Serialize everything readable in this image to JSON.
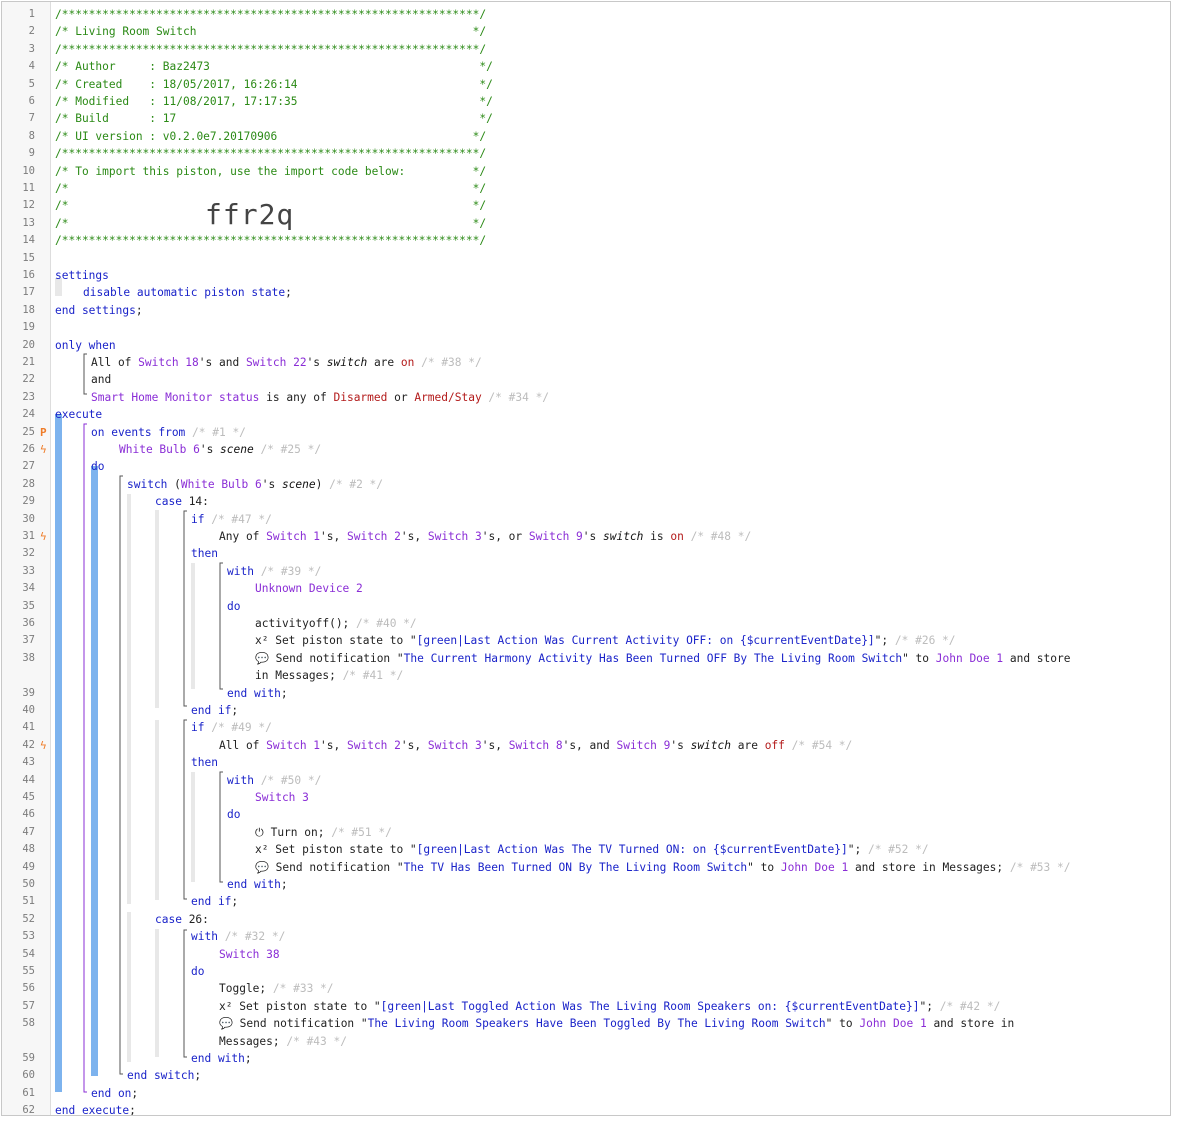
{
  "import_code": "ffr2q",
  "lines": [
    {
      "n": "1",
      "indent": 53,
      "t": [
        [
          "c",
          "/**************************************************************/"
        ]
      ]
    },
    {
      "n": "2",
      "indent": 53,
      "t": [
        [
          "c",
          "/* Living Room Switch                                         */"
        ]
      ]
    },
    {
      "n": "3",
      "indent": 53,
      "t": [
        [
          "c",
          "/**************************************************************/"
        ]
      ]
    },
    {
      "n": "4",
      "indent": 53,
      "t": [
        [
          "c",
          "/* Author     : Baz2473                                        */"
        ]
      ]
    },
    {
      "n": "5",
      "indent": 53,
      "t": [
        [
          "c",
          "/* Created    : 18/05/2017, 16:26:14                           */"
        ]
      ]
    },
    {
      "n": "6",
      "indent": 53,
      "t": [
        [
          "c",
          "/* Modified   : 11/08/2017, 17:17:35                           */"
        ]
      ]
    },
    {
      "n": "7",
      "indent": 53,
      "t": [
        [
          "c",
          "/* Build      : 17                                             */"
        ]
      ]
    },
    {
      "n": "8",
      "indent": 53,
      "t": [
        [
          "c",
          "/* UI version : v0.2.0e7.20170906                             */"
        ]
      ]
    },
    {
      "n": "9",
      "indent": 53,
      "t": [
        [
          "c",
          "/**************************************************************/"
        ]
      ]
    },
    {
      "n": "10",
      "indent": 53,
      "t": [
        [
          "c",
          "/* To import this piston, use the import code below:          */"
        ]
      ]
    },
    {
      "n": "11",
      "indent": 53,
      "t": [
        [
          "c",
          "/*                                                            */"
        ]
      ]
    },
    {
      "n": "12",
      "indent": 53,
      "t": [
        [
          "c",
          "/*                                                            */"
        ]
      ]
    },
    {
      "n": "13",
      "indent": 53,
      "t": [
        [
          "c",
          "/*                                                            */"
        ]
      ]
    },
    {
      "n": "14",
      "indent": 53,
      "t": [
        [
          "c",
          "/**************************************************************/"
        ]
      ]
    },
    {
      "n": "15",
      "indent": 53,
      "t": []
    },
    {
      "n": "16",
      "indent": 53,
      "t": [
        [
          "k",
          "settings"
        ]
      ]
    },
    {
      "n": "17",
      "indent": 81,
      "t": [
        [
          "k",
          "disable automatic piston state"
        ],
        [
          "p",
          ";"
        ]
      ]
    },
    {
      "n": "18",
      "indent": 53,
      "t": [
        [
          "k",
          "end settings"
        ],
        [
          "p",
          ";"
        ]
      ]
    },
    {
      "n": "19",
      "indent": 53,
      "t": []
    },
    {
      "n": "20",
      "indent": 53,
      "t": [
        [
          "k",
          "only when"
        ]
      ]
    },
    {
      "n": "21",
      "indent": 89,
      "t": [
        [
          "p",
          "All of "
        ],
        [
          "d",
          "Switch 18"
        ],
        [
          "p",
          "'s and "
        ],
        [
          "d",
          "Switch 22"
        ],
        [
          "p",
          "'s "
        ],
        [
          "a",
          "switch"
        ],
        [
          "p",
          " are "
        ],
        [
          "v",
          "on"
        ],
        [
          "x",
          " /* #38 */"
        ]
      ]
    },
    {
      "n": "22",
      "indent": 89,
      "t": [
        [
          "p",
          "and"
        ]
      ]
    },
    {
      "n": "23",
      "indent": 89,
      "t": [
        [
          "d",
          "Smart Home Monitor status"
        ],
        [
          "p",
          " is any of "
        ],
        [
          "v",
          "Disarmed"
        ],
        [
          "p",
          " or "
        ],
        [
          "v",
          "Armed/Stay"
        ],
        [
          "x",
          " /* #34 */"
        ]
      ]
    },
    {
      "n": "24",
      "indent": 53,
      "t": [
        [
          "k",
          "execute"
        ]
      ]
    },
    {
      "n": "25",
      "indent": 89,
      "flag": "P",
      "t": [
        [
          "k",
          "on events from"
        ],
        [
          "x",
          " /* #1 */"
        ]
      ]
    },
    {
      "n": "26",
      "indent": 117,
      "flag": "bolt",
      "t": [
        [
          "d",
          "White Bulb 6"
        ],
        [
          "p",
          "'s "
        ],
        [
          "a",
          "scene"
        ],
        [
          "x",
          " /* #25 */"
        ]
      ]
    },
    {
      "n": "27",
      "indent": 89,
      "t": [
        [
          "k",
          "do"
        ]
      ]
    },
    {
      "n": "28",
      "indent": 125,
      "t": [
        [
          "k",
          "switch"
        ],
        [
          "p",
          " ("
        ],
        [
          "d",
          "White Bulb 6"
        ],
        [
          "p",
          "'s "
        ],
        [
          "a",
          "scene"
        ],
        [
          "p",
          ")"
        ],
        [
          "x",
          " /* #2 */"
        ]
      ]
    },
    {
      "n": "29",
      "indent": 153,
      "t": [
        [
          "k",
          "case"
        ],
        [
          "p",
          " 14:"
        ]
      ]
    },
    {
      "n": "30",
      "indent": 189,
      "t": [
        [
          "k",
          "if"
        ],
        [
          "x",
          " /* #47 */"
        ]
      ]
    },
    {
      "n": "31",
      "indent": 217,
      "flag": "bolt",
      "t": [
        [
          "p",
          "Any of "
        ],
        [
          "d",
          "Switch 1"
        ],
        [
          "p",
          "'s, "
        ],
        [
          "d",
          "Switch 2"
        ],
        [
          "p",
          "'s, "
        ],
        [
          "d",
          "Switch 3"
        ],
        [
          "p",
          "'s, or "
        ],
        [
          "d",
          "Switch 9"
        ],
        [
          "p",
          "'s "
        ],
        [
          "a",
          "switch"
        ],
        [
          "p",
          " is "
        ],
        [
          "v",
          "on"
        ],
        [
          "x",
          " /* #48 */"
        ]
      ]
    },
    {
      "n": "32",
      "indent": 189,
      "t": [
        [
          "k",
          "then"
        ]
      ]
    },
    {
      "n": "33",
      "indent": 225,
      "t": [
        [
          "k",
          "with"
        ],
        [
          "x",
          " /* #39 */"
        ]
      ]
    },
    {
      "n": "34",
      "indent": 253,
      "t": [
        [
          "d",
          "Unknown Device 2"
        ]
      ]
    },
    {
      "n": "35",
      "indent": 225,
      "t": [
        [
          "k",
          "do"
        ]
      ]
    },
    {
      "n": "36",
      "indent": 253,
      "t": [
        [
          "p",
          "activityoff();"
        ],
        [
          "x",
          " /* #40 */"
        ]
      ]
    },
    {
      "n": "37",
      "indent": 253,
      "t": [
        [
          "p",
          "x² Set piston state to \""
        ],
        [
          "s",
          "[green|Last Action Was Current Activity OFF: on {$currentEventDate}]"
        ],
        [
          "p",
          "\";"
        ],
        [
          "x",
          " /* #26 */"
        ]
      ]
    },
    {
      "n": "38",
      "indent": 253,
      "t": [
        [
          "p",
          "💬 Send notification \""
        ],
        [
          "s",
          "The Current Harmony Activity Has Been Turned OFF By The Living Room Switch"
        ],
        [
          "p",
          "\" to "
        ],
        [
          "d",
          "John Doe 1"
        ],
        [
          "p",
          " and store"
        ]
      ]
    },
    {
      "n": "",
      "indent": 253,
      "t": [
        [
          "p",
          "in Messages;"
        ],
        [
          "x",
          " /* #41 */"
        ]
      ]
    },
    {
      "n": "39",
      "indent": 225,
      "t": [
        [
          "k",
          "end with"
        ],
        [
          "p",
          ";"
        ]
      ]
    },
    {
      "n": "40",
      "indent": 189,
      "t": [
        [
          "k",
          "end if"
        ],
        [
          "p",
          ";"
        ]
      ]
    },
    {
      "n": "41",
      "indent": 189,
      "t": [
        [
          "k",
          "if"
        ],
        [
          "x",
          " /* #49 */"
        ]
      ]
    },
    {
      "n": "42",
      "indent": 217,
      "flag": "bolt",
      "t": [
        [
          "p",
          "All of "
        ],
        [
          "d",
          "Switch 1"
        ],
        [
          "p",
          "'s, "
        ],
        [
          "d",
          "Switch 2"
        ],
        [
          "p",
          "'s, "
        ],
        [
          "d",
          "Switch 3"
        ],
        [
          "p",
          "'s, "
        ],
        [
          "d",
          "Switch 8"
        ],
        [
          "p",
          "'s, and "
        ],
        [
          "d",
          "Switch 9"
        ],
        [
          "p",
          "'s "
        ],
        [
          "a",
          "switch"
        ],
        [
          "p",
          " are "
        ],
        [
          "v",
          "off"
        ],
        [
          "x",
          " /* #54 */"
        ]
      ]
    },
    {
      "n": "43",
      "indent": 189,
      "t": [
        [
          "k",
          "then"
        ]
      ]
    },
    {
      "n": "44",
      "indent": 225,
      "t": [
        [
          "k",
          "with"
        ],
        [
          "x",
          " /* #50 */"
        ]
      ]
    },
    {
      "n": "45",
      "indent": 253,
      "t": [
        [
          "d",
          "Switch 3"
        ]
      ]
    },
    {
      "n": "46",
      "indent": 225,
      "t": [
        [
          "k",
          "do"
        ]
      ]
    },
    {
      "n": "47",
      "indent": 253,
      "t": [
        [
          "p",
          "⏻ Turn on;"
        ],
        [
          "x",
          " /* #51 */"
        ]
      ]
    },
    {
      "n": "48",
      "indent": 253,
      "t": [
        [
          "p",
          "x² Set piston state to \""
        ],
        [
          "s",
          "[green|Last Action Was The TV Turned ON: on {$currentEventDate}]"
        ],
        [
          "p",
          "\";"
        ],
        [
          "x",
          " /* #52 */"
        ]
      ]
    },
    {
      "n": "49",
      "indent": 253,
      "t": [
        [
          "p",
          "💬 Send notification \""
        ],
        [
          "s",
          "The TV Has Been Turned ON By The Living Room Switch"
        ],
        [
          "p",
          "\" to "
        ],
        [
          "d",
          "John Doe 1"
        ],
        [
          "p",
          " and store in Messages;"
        ],
        [
          "x",
          " /* #53 */"
        ]
      ]
    },
    {
      "n": "50",
      "indent": 225,
      "t": [
        [
          "k",
          "end with"
        ],
        [
          "p",
          ";"
        ]
      ]
    },
    {
      "n": "51",
      "indent": 189,
      "t": [
        [
          "k",
          "end if"
        ],
        [
          "p",
          ";"
        ]
      ]
    },
    {
      "n": "52",
      "indent": 153,
      "t": [
        [
          "k",
          "case"
        ],
        [
          "p",
          " 26:"
        ]
      ]
    },
    {
      "n": "53",
      "indent": 189,
      "t": [
        [
          "k",
          "with"
        ],
        [
          "x",
          " /* #32 */"
        ]
      ]
    },
    {
      "n": "54",
      "indent": 217,
      "t": [
        [
          "d",
          "Switch 38"
        ]
      ]
    },
    {
      "n": "55",
      "indent": 189,
      "t": [
        [
          "k",
          "do"
        ]
      ]
    },
    {
      "n": "56",
      "indent": 217,
      "t": [
        [
          "p",
          "Toggle;"
        ],
        [
          "x",
          " /* #33 */"
        ]
      ]
    },
    {
      "n": "57",
      "indent": 217,
      "t": [
        [
          "p",
          "x² Set piston state to \""
        ],
        [
          "s",
          "[green|Last Toggled Action Was The Living Room Speakers on: {$currentEventDate}]"
        ],
        [
          "p",
          "\";"
        ],
        [
          "x",
          " /* #42 */"
        ]
      ]
    },
    {
      "n": "58",
      "indent": 217,
      "t": [
        [
          "p",
          "💬 Send notification \""
        ],
        [
          "s",
          "The Living Room Speakers Have Been Toggled By The Living Room Switch"
        ],
        [
          "p",
          "\" to "
        ],
        [
          "d",
          "John Doe 1"
        ],
        [
          "p",
          " and store in"
        ]
      ]
    },
    {
      "n": "",
      "indent": 217,
      "t": [
        [
          "p",
          "Messages;"
        ],
        [
          "x",
          " /* #43 */"
        ]
      ]
    },
    {
      "n": "59",
      "indent": 189,
      "t": [
        [
          "k",
          "end with"
        ],
        [
          "p",
          ";"
        ]
      ]
    },
    {
      "n": "60",
      "indent": 125,
      "t": [
        [
          "k",
          "end switch"
        ],
        [
          "p",
          ";"
        ]
      ]
    },
    {
      "n": "61",
      "indent": 89,
      "t": [
        [
          "k",
          "end on"
        ],
        [
          "p",
          ";"
        ]
      ]
    },
    {
      "n": "62",
      "indent": 53,
      "t": [
        [
          "k",
          "end execute"
        ],
        [
          "p",
          ";"
        ]
      ]
    }
  ]
}
